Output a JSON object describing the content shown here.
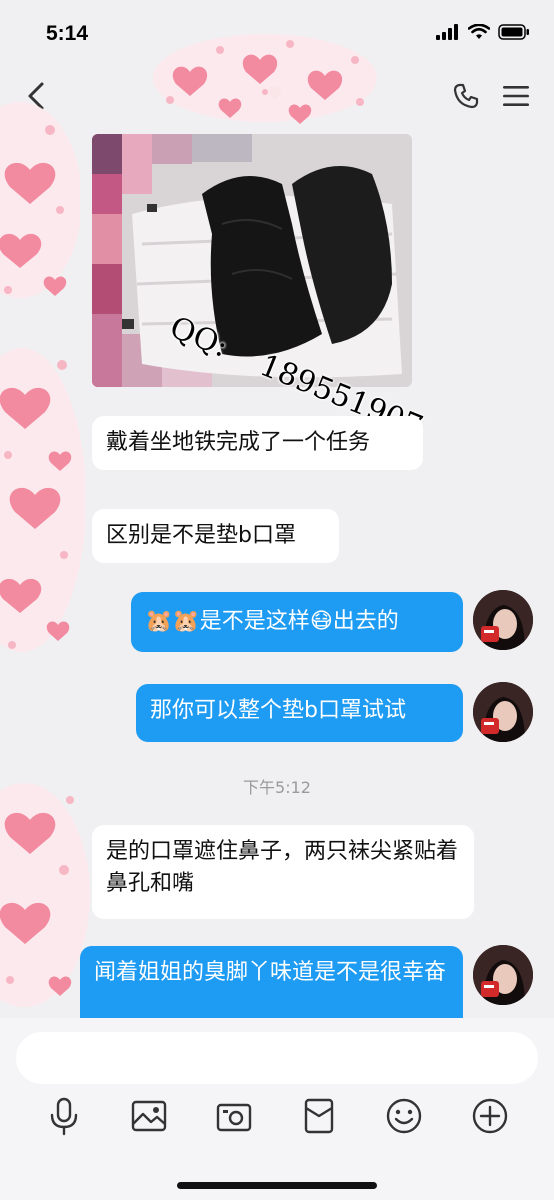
{
  "status_bar": {
    "time": "5:14"
  },
  "header": {
    "title": "♥"
  },
  "watermark": {
    "line1": "QQ: ",
    "line2": "189551907"
  },
  "messages": [
    {
      "side": "left",
      "text": "戴着坐地铁完成了一个任务"
    },
    {
      "side": "left",
      "text": "区别是不是垫b口罩"
    },
    {
      "side": "right",
      "text": "🐹🐹是不是这样😷出去的"
    },
    {
      "side": "right",
      "text": "那你可以整个垫b口罩试试"
    },
    {
      "side": "left",
      "text": "是的口罩遮住鼻子，两只袜尖紧贴着鼻孔和嘴"
    },
    {
      "side": "right",
      "text": "闻着姐姐的臭脚丫味道是不是很幸奋"
    }
  ],
  "timestamp": "下午5:12",
  "input": {
    "placeholder": ""
  },
  "toolbar": [
    "microphone-icon",
    "image-icon",
    "camera-icon",
    "red-packet-icon",
    "emoji-icon",
    "plus-icon"
  ],
  "colors": {
    "right_bubble": "#1e9bf2",
    "left_bubble": "#ffffff",
    "background": "#f0f0f2"
  }
}
